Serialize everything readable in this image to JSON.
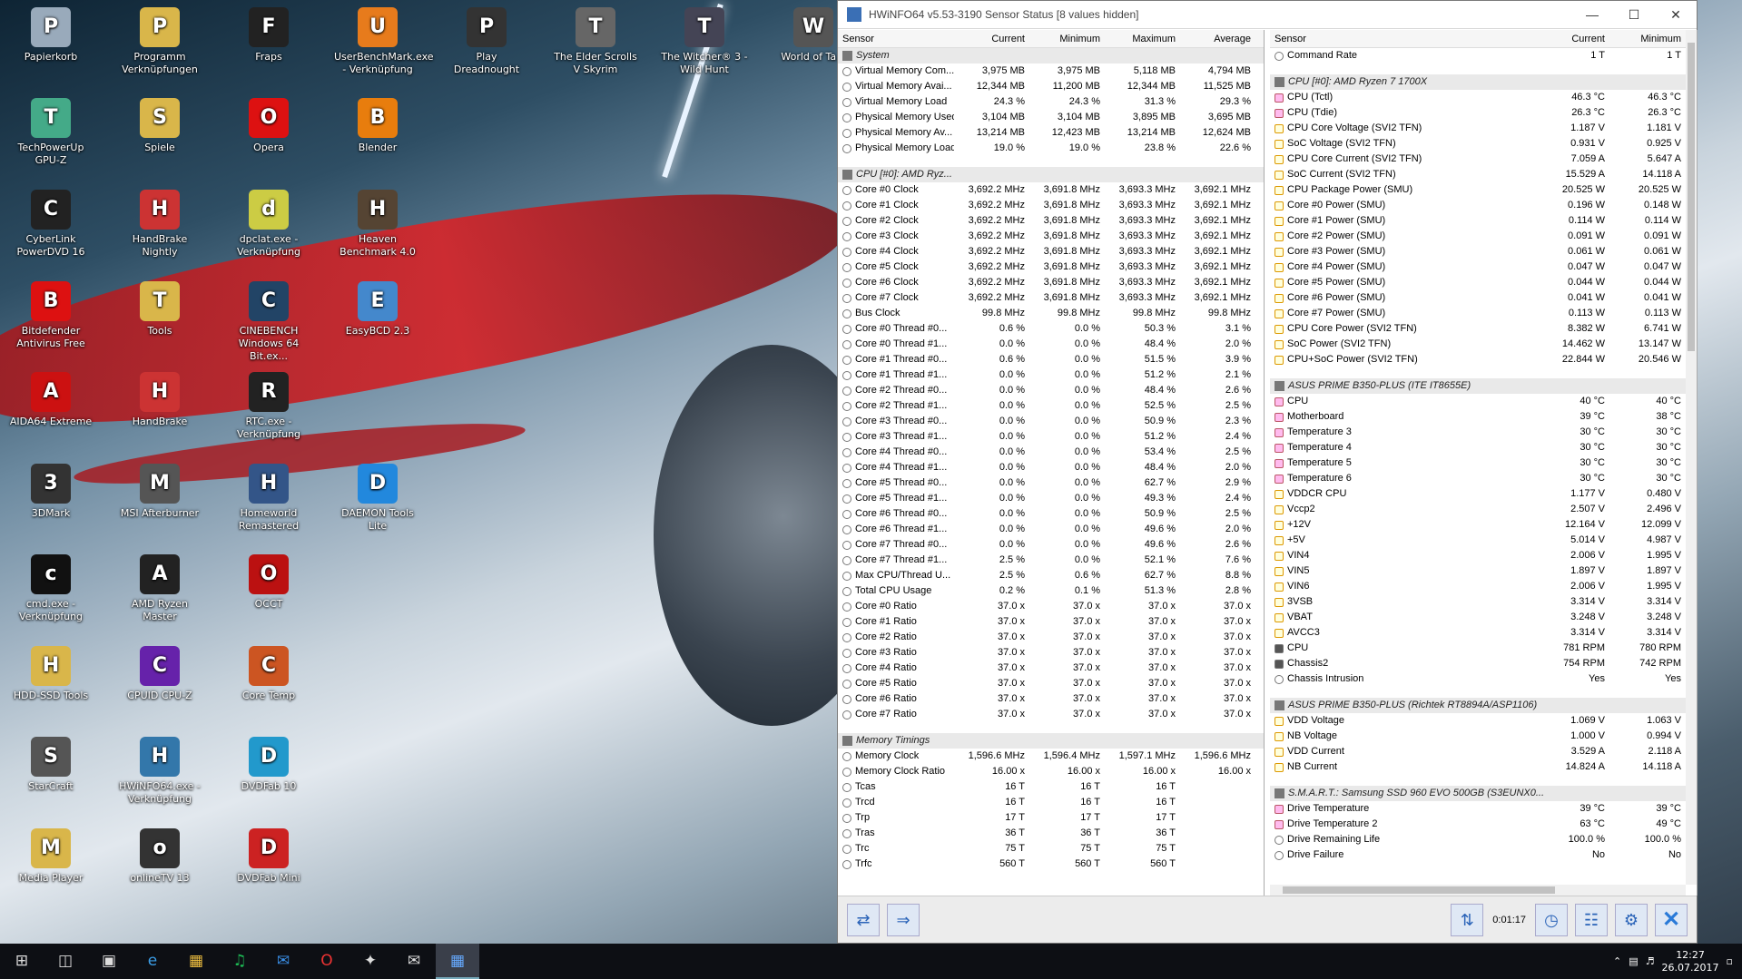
{
  "window": {
    "title": "HWiNFO64 v5.53-3190 Sensor Status [8 values hidden]"
  },
  "desktop_icons": [
    {
      "label": "Papierkorb",
      "icon": "recycle-bin-icon",
      "color": "#9ab"
    },
    {
      "label": "Programm Verknüpfungen",
      "icon": "folder-icon",
      "color": "#d9b64a"
    },
    {
      "label": "Fraps",
      "icon": "fraps-icon",
      "color": "#222"
    },
    {
      "label": "UserBenchMark.exe - Verknüpfung",
      "icon": "userbenchmark-icon",
      "color": "#e77b1c"
    },
    {
      "label": "Play Dreadnought",
      "icon": "dreadnought-icon",
      "color": "#333"
    },
    {
      "label": "The Elder Scrolls V Skyrim",
      "icon": "skyrim-icon",
      "color": "#666"
    },
    {
      "label": "The Witcher® 3 - Wild Hunt",
      "icon": "witcher-icon",
      "color": "#445"
    },
    {
      "label": "World of Ta...",
      "icon": "wot-icon",
      "color": "#555"
    },
    {
      "label": "TechPowerUp GPU-Z",
      "icon": "gpuz-icon",
      "color": "#4a8"
    },
    {
      "label": "Spiele",
      "icon": "folder-icon",
      "color": "#d9b64a"
    },
    {
      "label": "Opera",
      "icon": "opera-icon",
      "color": "#d11"
    },
    {
      "label": "Blender",
      "icon": "blender-icon",
      "color": "#e87d0d"
    },
    {
      "label": "CyberLink PowerDVD 16",
      "icon": "powerdvd-icon",
      "color": "#222"
    },
    {
      "label": "HandBrake Nightly",
      "icon": "handbrake-icon",
      "color": "#c33"
    },
    {
      "label": "dpclat.exe - Verknüpfung",
      "icon": "dpclat-icon",
      "color": "#cc4"
    },
    {
      "label": "Heaven Benchmark 4.0",
      "icon": "heaven-icon",
      "color": "#543"
    },
    {
      "label": "Bitdefender Antivirus Free",
      "icon": "bitdefender-icon",
      "color": "#d11"
    },
    {
      "label": "Tools",
      "icon": "folder-icon",
      "color": "#d9b64a"
    },
    {
      "label": "CINEBENCH Windows 64 Bit.ex...",
      "icon": "cinebench-icon",
      "color": "#246"
    },
    {
      "label": "EasyBCD 2.3",
      "icon": "easybcd-icon",
      "color": "#48c"
    },
    {
      "label": "AIDA64 Extreme",
      "icon": "aida64-icon",
      "color": "#c11"
    },
    {
      "label": "HandBrake",
      "icon": "handbrake-icon",
      "color": "#c33"
    },
    {
      "label": "RTC.exe - Verknüpfung",
      "icon": "rtc-icon",
      "color": "#222"
    },
    {
      "label": "3DMark",
      "icon": "3dmark-icon",
      "color": "#333"
    },
    {
      "label": "MSI Afterburner",
      "icon": "afterburner-icon",
      "color": "#555"
    },
    {
      "label": "Homeworld Remastered",
      "icon": "homeworld-icon",
      "color": "#358"
    },
    {
      "label": "DAEMON Tools Lite",
      "icon": "daemon-icon",
      "color": "#28d"
    },
    {
      "label": "cmd.exe - Verknüpfung",
      "icon": "cmd-icon",
      "color": "#111"
    },
    {
      "label": "AMD Ryzen Master",
      "icon": "ryzen-icon",
      "color": "#222"
    },
    {
      "label": "OCCT",
      "icon": "occt-icon",
      "color": "#b11"
    },
    {
      "label": "HDD-SSD Tools",
      "icon": "folder-icon",
      "color": "#d9b64a"
    },
    {
      "label": "CPUID CPU-Z",
      "icon": "cpuz-icon",
      "color": "#62a"
    },
    {
      "label": "Core Temp",
      "icon": "coretemp-icon",
      "color": "#c52"
    },
    {
      "label": "StarCraft",
      "icon": "starcraft-icon",
      "color": "#555"
    },
    {
      "label": "HWiNFO64.exe - Verknüpfung",
      "icon": "hwinfo-icon",
      "color": "#37a"
    },
    {
      "label": "DVDFab 10",
      "icon": "dvdfab-icon",
      "color": "#29c"
    },
    {
      "label": "Media Player",
      "icon": "folder-icon",
      "color": "#d9b64a"
    },
    {
      "label": "onlineTV 13",
      "icon": "onlinetv-icon",
      "color": "#333"
    },
    {
      "label": "DVDFab Mini",
      "icon": "dvdfab-icon",
      "color": "#c22"
    }
  ],
  "left_pane": {
    "headers": [
      "Sensor",
      "Current",
      "Minimum",
      "Maximum",
      "Average"
    ],
    "rows": [
      {
        "g": "System"
      },
      {
        "n": "Virtual Memory Com...",
        "v": [
          "3,975 MB",
          "3,975 MB",
          "5,118 MB",
          "4,794 MB"
        ]
      },
      {
        "n": "Virtual Memory Avai...",
        "v": [
          "12,344 MB",
          "11,200 MB",
          "12,344 MB",
          "11,525 MB"
        ]
      },
      {
        "n": "Virtual Memory Load",
        "v": [
          "24.3 %",
          "24.3 %",
          "31.3 %",
          "29.3 %"
        ]
      },
      {
        "n": "Physical Memory Used",
        "v": [
          "3,104 MB",
          "3,104 MB",
          "3,895 MB",
          "3,695 MB"
        ]
      },
      {
        "n": "Physical Memory Av...",
        "v": [
          "13,214 MB",
          "12,423 MB",
          "13,214 MB",
          "12,624 MB"
        ]
      },
      {
        "n": "Physical Memory Load",
        "v": [
          "19.0 %",
          "19.0 %",
          "23.8 %",
          "22.6 %"
        ]
      },
      {
        "gap": 1
      },
      {
        "g": "CPU [#0]: AMD Ryz..."
      },
      {
        "n": "Core #0 Clock",
        "v": [
          "3,692.2 MHz",
          "3,691.8 MHz",
          "3,693.3 MHz",
          "3,692.1 MHz"
        ]
      },
      {
        "n": "Core #1 Clock",
        "v": [
          "3,692.2 MHz",
          "3,691.8 MHz",
          "3,693.3 MHz",
          "3,692.1 MHz"
        ]
      },
      {
        "n": "Core #2 Clock",
        "v": [
          "3,692.2 MHz",
          "3,691.8 MHz",
          "3,693.3 MHz",
          "3,692.1 MHz"
        ]
      },
      {
        "n": "Core #3 Clock",
        "v": [
          "3,692.2 MHz",
          "3,691.8 MHz",
          "3,693.3 MHz",
          "3,692.1 MHz"
        ]
      },
      {
        "n": "Core #4 Clock",
        "v": [
          "3,692.2 MHz",
          "3,691.8 MHz",
          "3,693.3 MHz",
          "3,692.1 MHz"
        ]
      },
      {
        "n": "Core #5 Clock",
        "v": [
          "3,692.2 MHz",
          "3,691.8 MHz",
          "3,693.3 MHz",
          "3,692.1 MHz"
        ]
      },
      {
        "n": "Core #6 Clock",
        "v": [
          "3,692.2 MHz",
          "3,691.8 MHz",
          "3,693.3 MHz",
          "3,692.1 MHz"
        ]
      },
      {
        "n": "Core #7 Clock",
        "v": [
          "3,692.2 MHz",
          "3,691.8 MHz",
          "3,693.3 MHz",
          "3,692.1 MHz"
        ]
      },
      {
        "n": "Bus Clock",
        "v": [
          "99.8 MHz",
          "99.8 MHz",
          "99.8 MHz",
          "99.8 MHz"
        ]
      },
      {
        "n": "Core #0 Thread #0...",
        "v": [
          "0.6 %",
          "0.0 %",
          "50.3 %",
          "3.1 %"
        ]
      },
      {
        "n": "Core #0 Thread #1...",
        "v": [
          "0.0 %",
          "0.0 %",
          "48.4 %",
          "2.0 %"
        ]
      },
      {
        "n": "Core #1 Thread #0...",
        "v": [
          "0.6 %",
          "0.0 %",
          "51.5 %",
          "3.9 %"
        ]
      },
      {
        "n": "Core #1 Thread #1...",
        "v": [
          "0.0 %",
          "0.0 %",
          "51.2 %",
          "2.1 %"
        ]
      },
      {
        "n": "Core #2 Thread #0...",
        "v": [
          "0.0 %",
          "0.0 %",
          "48.4 %",
          "2.6 %"
        ]
      },
      {
        "n": "Core #2 Thread #1...",
        "v": [
          "0.0 %",
          "0.0 %",
          "52.5 %",
          "2.5 %"
        ]
      },
      {
        "n": "Core #3 Thread #0...",
        "v": [
          "0.0 %",
          "0.0 %",
          "50.9 %",
          "2.3 %"
        ]
      },
      {
        "n": "Core #3 Thread #1...",
        "v": [
          "0.0 %",
          "0.0 %",
          "51.2 %",
          "2.4 %"
        ]
      },
      {
        "n": "Core #4 Thread #0...",
        "v": [
          "0.0 %",
          "0.0 %",
          "53.4 %",
          "2.5 %"
        ]
      },
      {
        "n": "Core #4 Thread #1...",
        "v": [
          "0.0 %",
          "0.0 %",
          "48.4 %",
          "2.0 %"
        ]
      },
      {
        "n": "Core #5 Thread #0...",
        "v": [
          "0.0 %",
          "0.0 %",
          "62.7 %",
          "2.9 %"
        ]
      },
      {
        "n": "Core #5 Thread #1...",
        "v": [
          "0.0 %",
          "0.0 %",
          "49.3 %",
          "2.4 %"
        ]
      },
      {
        "n": "Core #6 Thread #0...",
        "v": [
          "0.0 %",
          "0.0 %",
          "50.9 %",
          "2.5 %"
        ]
      },
      {
        "n": "Core #6 Thread #1...",
        "v": [
          "0.0 %",
          "0.0 %",
          "49.6 %",
          "2.0 %"
        ]
      },
      {
        "n": "Core #7 Thread #0...",
        "v": [
          "0.0 %",
          "0.0 %",
          "49.6 %",
          "2.6 %"
        ]
      },
      {
        "n": "Core #7 Thread #1...",
        "v": [
          "2.5 %",
          "0.0 %",
          "52.1 %",
          "7.6 %"
        ]
      },
      {
        "n": "Max CPU/Thread U...",
        "v": [
          "2.5 %",
          "0.6 %",
          "62.7 %",
          "8.8 %"
        ]
      },
      {
        "n": "Total CPU Usage",
        "v": [
          "0.2 %",
          "0.1 %",
          "51.3 %",
          "2.8 %"
        ]
      },
      {
        "n": "Core #0 Ratio",
        "v": [
          "37.0 x",
          "37.0 x",
          "37.0 x",
          "37.0 x"
        ]
      },
      {
        "n": "Core #1 Ratio",
        "v": [
          "37.0 x",
          "37.0 x",
          "37.0 x",
          "37.0 x"
        ]
      },
      {
        "n": "Core #2 Ratio",
        "v": [
          "37.0 x",
          "37.0 x",
          "37.0 x",
          "37.0 x"
        ]
      },
      {
        "n": "Core #3 Ratio",
        "v": [
          "37.0 x",
          "37.0 x",
          "37.0 x",
          "37.0 x"
        ]
      },
      {
        "n": "Core #4 Ratio",
        "v": [
          "37.0 x",
          "37.0 x",
          "37.0 x",
          "37.0 x"
        ]
      },
      {
        "n": "Core #5 Ratio",
        "v": [
          "37.0 x",
          "37.0 x",
          "37.0 x",
          "37.0 x"
        ]
      },
      {
        "n": "Core #6 Ratio",
        "v": [
          "37.0 x",
          "37.0 x",
          "37.0 x",
          "37.0 x"
        ]
      },
      {
        "n": "Core #7 Ratio",
        "v": [
          "37.0 x",
          "37.0 x",
          "37.0 x",
          "37.0 x"
        ]
      },
      {
        "gap": 1
      },
      {
        "g": "Memory Timings"
      },
      {
        "n": "Memory Clock",
        "v": [
          "1,596.6 MHz",
          "1,596.4 MHz",
          "1,597.1 MHz",
          "1,596.6 MHz"
        ]
      },
      {
        "n": "Memory Clock Ratio",
        "v": [
          "16.00 x",
          "16.00 x",
          "16.00 x",
          "16.00 x"
        ]
      },
      {
        "n": "Tcas",
        "v": [
          "16 T",
          "16 T",
          "16 T",
          ""
        ]
      },
      {
        "n": "Trcd",
        "v": [
          "16 T",
          "16 T",
          "16 T",
          ""
        ]
      },
      {
        "n": "Trp",
        "v": [
          "17 T",
          "17 T",
          "17 T",
          ""
        ]
      },
      {
        "n": "Tras",
        "v": [
          "36 T",
          "36 T",
          "36 T",
          ""
        ]
      },
      {
        "n": "Trc",
        "v": [
          "75 T",
          "75 T",
          "75 T",
          ""
        ]
      },
      {
        "n": "Trfc",
        "v": [
          "560 T",
          "560 T",
          "560 T",
          ""
        ]
      }
    ]
  },
  "right_pane": {
    "headers": [
      "Sensor",
      "Current",
      "Minimum"
    ],
    "rows": [
      {
        "n": "Command Rate",
        "v": [
          "1 T",
          "1 T"
        ],
        "i": "c"
      },
      {
        "gap": 1
      },
      {
        "g": "CPU [#0]: AMD Ryzen 7 1700X"
      },
      {
        "n": "CPU (Tctl)",
        "v": [
          "46.3 °C",
          "46.3 °C"
        ],
        "i": "t"
      },
      {
        "n": "CPU (Tdie)",
        "v": [
          "26.3 °C",
          "26.3 °C"
        ],
        "i": "t"
      },
      {
        "n": "CPU Core Voltage (SVI2 TFN)",
        "v": [
          "1.187 V",
          "1.181 V"
        ],
        "i": "v"
      },
      {
        "n": "SoC Voltage (SVI2 TFN)",
        "v": [
          "0.931 V",
          "0.925 V"
        ],
        "i": "v"
      },
      {
        "n": "CPU Core Current (SVI2 TFN)",
        "v": [
          "7.059 A",
          "5.647 A"
        ],
        "i": "v"
      },
      {
        "n": "SoC Current (SVI2 TFN)",
        "v": [
          "15.529 A",
          "14.118 A"
        ],
        "i": "v"
      },
      {
        "n": "CPU Package Power (SMU)",
        "v": [
          "20.525 W",
          "20.525 W"
        ],
        "i": "v"
      },
      {
        "n": "Core #0 Power (SMU)",
        "v": [
          "0.196 W",
          "0.148 W"
        ],
        "i": "v"
      },
      {
        "n": "Core #1 Power (SMU)",
        "v": [
          "0.114 W",
          "0.114 W"
        ],
        "i": "v"
      },
      {
        "n": "Core #2 Power (SMU)",
        "v": [
          "0.091 W",
          "0.091 W"
        ],
        "i": "v"
      },
      {
        "n": "Core #3 Power (SMU)",
        "v": [
          "0.061 W",
          "0.061 W"
        ],
        "i": "v"
      },
      {
        "n": "Core #4 Power (SMU)",
        "v": [
          "0.047 W",
          "0.047 W"
        ],
        "i": "v"
      },
      {
        "n": "Core #5 Power (SMU)",
        "v": [
          "0.044 W",
          "0.044 W"
        ],
        "i": "v"
      },
      {
        "n": "Core #6 Power (SMU)",
        "v": [
          "0.041 W",
          "0.041 W"
        ],
        "i": "v"
      },
      {
        "n": "Core #7 Power (SMU)",
        "v": [
          "0.113 W",
          "0.113 W"
        ],
        "i": "v"
      },
      {
        "n": "CPU Core Power (SVI2 TFN)",
        "v": [
          "8.382 W",
          "6.741 W"
        ],
        "i": "v"
      },
      {
        "n": "SoC Power (SVI2 TFN)",
        "v": [
          "14.462 W",
          "13.147 W"
        ],
        "i": "v"
      },
      {
        "n": "CPU+SoC Power (SVI2 TFN)",
        "v": [
          "22.844 W",
          "20.546 W"
        ],
        "i": "v"
      },
      {
        "gap": 1
      },
      {
        "g": "ASUS PRIME B350-PLUS (ITE IT8655E)"
      },
      {
        "n": "CPU",
        "v": [
          "40 °C",
          "40 °C"
        ],
        "i": "t"
      },
      {
        "n": "Motherboard",
        "v": [
          "39 °C",
          "38 °C"
        ],
        "i": "t"
      },
      {
        "n": "Temperature 3",
        "v": [
          "30 °C",
          "30 °C"
        ],
        "i": "t"
      },
      {
        "n": "Temperature 4",
        "v": [
          "30 °C",
          "30 °C"
        ],
        "i": "t"
      },
      {
        "n": "Temperature 5",
        "v": [
          "30 °C",
          "30 °C"
        ],
        "i": "t"
      },
      {
        "n": "Temperature 6",
        "v": [
          "30 °C",
          "30 °C"
        ],
        "i": "t"
      },
      {
        "n": "VDDCR CPU",
        "v": [
          "1.177 V",
          "0.480 V"
        ],
        "i": "v"
      },
      {
        "n": "Vccp2",
        "v": [
          "2.507 V",
          "2.496 V"
        ],
        "i": "v"
      },
      {
        "n": "+12V",
        "v": [
          "12.164 V",
          "12.099 V"
        ],
        "i": "v"
      },
      {
        "n": "+5V",
        "v": [
          "5.014 V",
          "4.987 V"
        ],
        "i": "v"
      },
      {
        "n": "VIN4",
        "v": [
          "2.006 V",
          "1.995 V"
        ],
        "i": "v"
      },
      {
        "n": "VIN5",
        "v": [
          "1.897 V",
          "1.897 V"
        ],
        "i": "v"
      },
      {
        "n": "VIN6",
        "v": [
          "2.006 V",
          "1.995 V"
        ],
        "i": "v"
      },
      {
        "n": "3VSB",
        "v": [
          "3.314 V",
          "3.314 V"
        ],
        "i": "v"
      },
      {
        "n": "VBAT",
        "v": [
          "3.248 V",
          "3.248 V"
        ],
        "i": "v"
      },
      {
        "n": "AVCC3",
        "v": [
          "3.314 V",
          "3.314 V"
        ],
        "i": "v"
      },
      {
        "n": "CPU",
        "v": [
          "781 RPM",
          "780 RPM"
        ],
        "i": "g"
      },
      {
        "n": "Chassis2",
        "v": [
          "754 RPM",
          "742 RPM"
        ],
        "i": "g"
      },
      {
        "n": "Chassis Intrusion",
        "v": [
          "Yes",
          "Yes"
        ],
        "i": "c"
      },
      {
        "gap": 1
      },
      {
        "g": "ASUS PRIME B350-PLUS (Richtek RT8894A/ASP1106)"
      },
      {
        "n": "VDD Voltage",
        "v": [
          "1.069 V",
          "1.063 V"
        ],
        "i": "v"
      },
      {
        "n": "NB Voltage",
        "v": [
          "1.000 V",
          "0.994 V"
        ],
        "i": "v"
      },
      {
        "n": "VDD Current",
        "v": [
          "3.529 A",
          "2.118 A"
        ],
        "i": "v"
      },
      {
        "n": "NB Current",
        "v": [
          "14.824 A",
          "14.118 A"
        ],
        "i": "v"
      },
      {
        "gap": 1
      },
      {
        "g": "S.M.A.R.T.: Samsung SSD 960 EVO 500GB (S3EUNX0..."
      },
      {
        "n": "Drive Temperature",
        "v": [
          "39 °C",
          "39 °C"
        ],
        "i": "t"
      },
      {
        "n": "Drive Temperature 2",
        "v": [
          "63 °C",
          "49 °C"
        ],
        "i": "t"
      },
      {
        "n": "Drive Remaining Life",
        "v": [
          "100.0 %",
          "100.0 %"
        ],
        "i": "c"
      },
      {
        "n": "Drive Failure",
        "v": [
          "No",
          "No"
        ],
        "i": "c"
      }
    ]
  },
  "bottom": {
    "timer": "0:01:17"
  },
  "tray": {
    "time": "12:27",
    "date": "26.07.2017"
  }
}
